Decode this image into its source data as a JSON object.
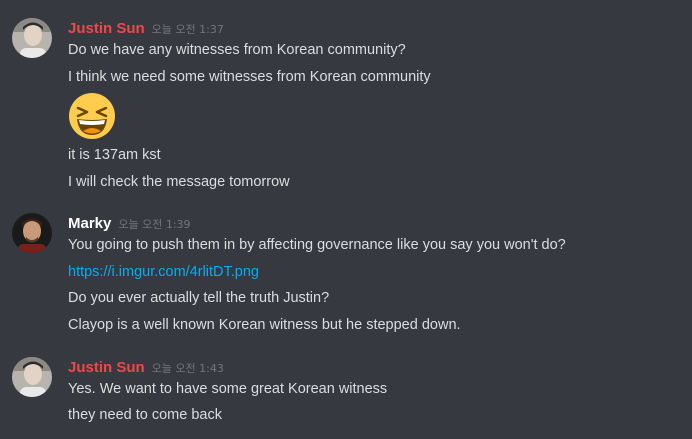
{
  "messages": [
    {
      "author": "Justin Sun",
      "author_color": "#f04747",
      "timestamp": "오늘 오전 1:37",
      "avatar_icon": "person-avatar-icon",
      "lines": [
        "Do we have any witnesses from Korean community?",
        "I think we need some witnesses from Korean community",
        "it is 137am kst",
        "I will check the message tomorrow"
      ],
      "emoji": "laughing-face-emoji-icon"
    },
    {
      "author": "Marky",
      "author_color": "#ffffff",
      "timestamp": "오늘 오전 1:39",
      "avatar_icon": "person-avatar-icon",
      "lines": [
        "You going to push them in by affecting governance like you say you won't do?",
        "https://i.imgur.com/4rlitDT.png",
        "Do you ever actually tell the truth Justin?",
        "Clayop is a well known Korean witness but he stepped down."
      ]
    },
    {
      "author": "Justin Sun",
      "author_color": "#f04747",
      "timestamp": "오늘 오전 1:43",
      "avatar_icon": "person-avatar-icon",
      "lines": [
        "Yes. We want to have some great Korean witness",
        "they need to come back"
      ]
    }
  ]
}
